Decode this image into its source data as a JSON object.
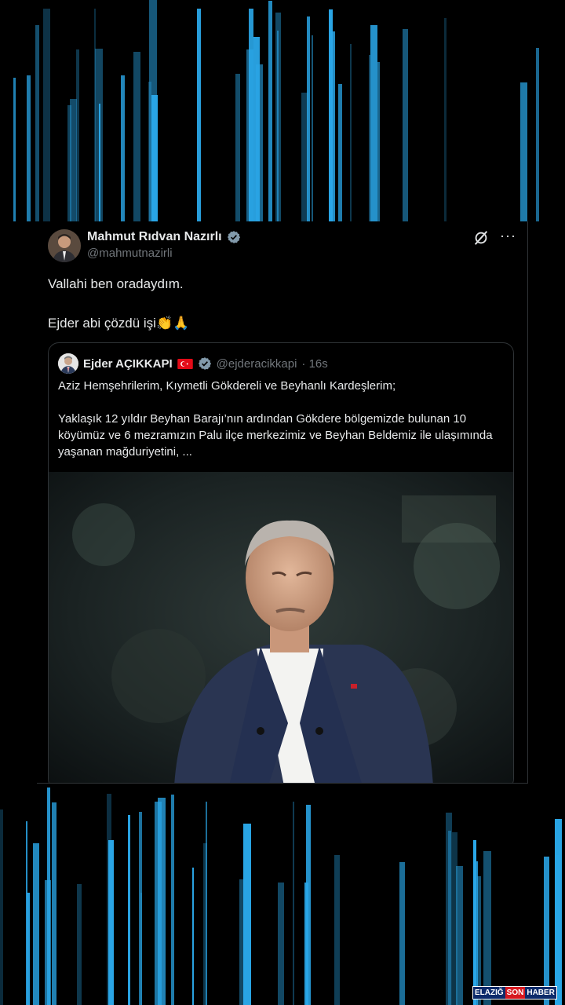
{
  "tweet": {
    "author_name": "Mahmut Rıdvan Nazırlı",
    "author_handle": "@mahmutnazirli",
    "line1": "Vallahi ben oradaydım.",
    "line2": "Ejder abi çözdü işi👏🙏",
    "more_label": "···"
  },
  "quote": {
    "author_name": "Ejder AÇIKKAPI",
    "author_handle": "@ejderacikkapi",
    "time": "· 16s",
    "paragraph1": "Aziz Hemşehrilerim, Kıymetli Gökdereli ve Beyhanlı Kardeşlerim;",
    "paragraph2": "Yaklaşık 12 yıldır Beyhan Barajı’nın ardından Gökdere bölgemizde bulunan 10 köyümüz ve 6 mezramızın Palu ilçe merkezimiz ve Beyhan Beldemiz ile ulaşımında yaşanan mağduriyetini, ..."
  },
  "watermark": {
    "part1": "ELAZIĞ",
    "part2": "SON",
    "part3": "HABER"
  },
  "icons": [
    "verified-badge-icon",
    "grok-icon",
    "more-icon",
    "turkey-flag-icon"
  ],
  "colors": {
    "background": "#000000",
    "stripe": "#2aa7e8",
    "text": "#e7e9ea",
    "muted": "#71767b",
    "verified": "#829aab"
  }
}
